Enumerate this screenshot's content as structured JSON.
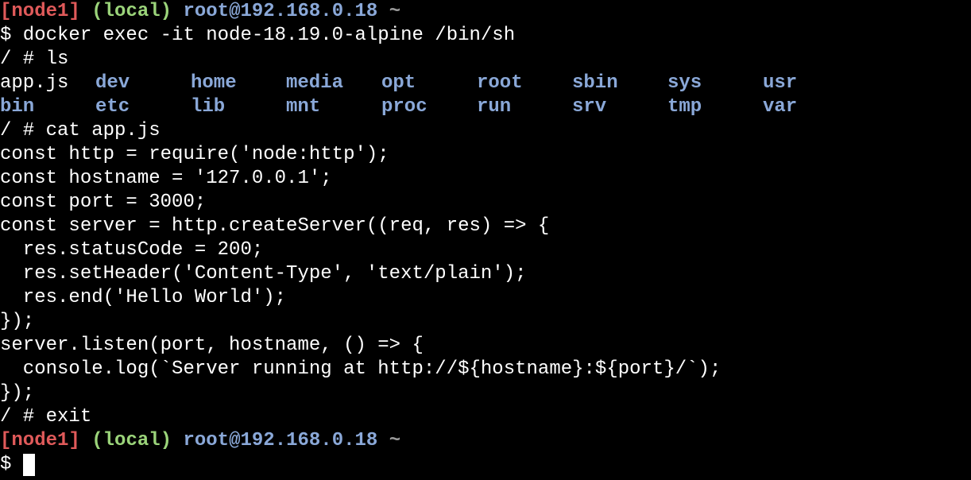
{
  "prompt": {
    "node": "[node1]",
    "env": "(local)",
    "user_host": "root@192.168.0.18",
    "tilde": "~"
  },
  "lines": {
    "l2": "$ docker exec -it node-18.19.0-alpine /bin/sh",
    "l3": "/ # ls",
    "l6": "/ # cat app.js",
    "l7": "const http = require('node:http');",
    "l8": "const hostname = '127.0.0.1';",
    "l9": "const port = 3000;",
    "l10": "const server = http.createServer((req, res) => {",
    "l11": "  res.statusCode = 200;",
    "l12": "  res.setHeader('Content-Type', 'text/plain');",
    "l13": "  res.end('Hello World');",
    "l14": "});",
    "l15": "server.listen(port, hostname, () => {",
    "l16": "  console.log(`Server running at http://${hostname}:${port}/`);",
    "l17": "});",
    "l18": "/ # exit",
    "l20": "$ "
  },
  "ls": {
    "row1": [
      "app.js",
      "dev",
      "home",
      "media",
      "opt",
      "root",
      "sbin",
      "sys",
      "usr"
    ],
    "row2": [
      "bin",
      "etc",
      "lib",
      "mnt",
      "proc",
      "run",
      "srv",
      "tmp",
      "var"
    ]
  },
  "colors": {
    "background": "#000000",
    "text": "#ffffff",
    "node": "#e05a5a",
    "env": "#9bd47a",
    "user_host": "#8aa8d8",
    "directory": "#8aa8d8",
    "tilde": "#9a9a9a"
  }
}
